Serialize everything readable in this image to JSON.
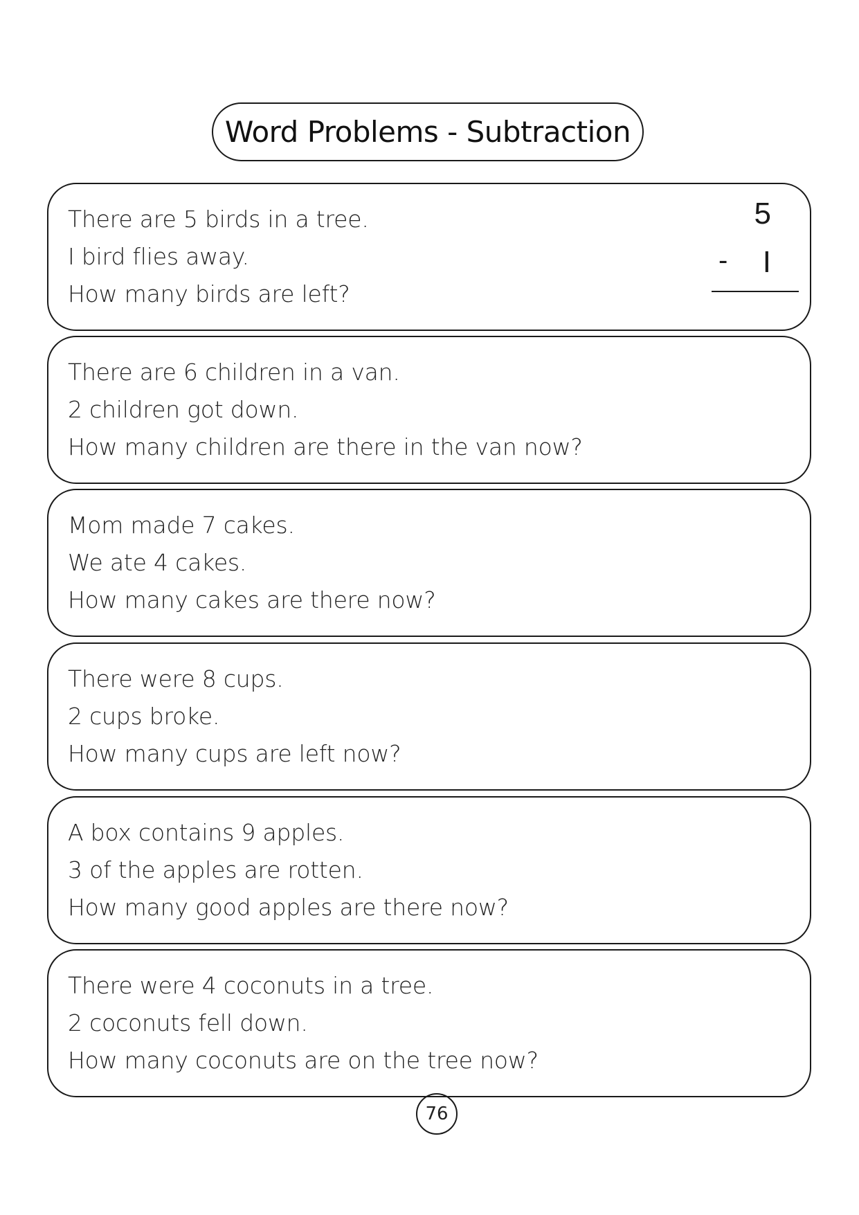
{
  "title": "Word Problems - Subtraction",
  "problems": [
    {
      "lines": [
        "There are 5 birds in a tree.",
        "I bird flies away.",
        "How many birds are left?"
      ],
      "example": {
        "top": "5",
        "operator": "-",
        "bottom": "I"
      }
    },
    {
      "lines": [
        "There are 6 children in a van.",
        "2 children got down.",
        "How many children are there in the van now?"
      ]
    },
    {
      "lines": [
        "Mom made 7 cakes.",
        "We ate 4 cakes.",
        "How many cakes are there now?"
      ]
    },
    {
      "lines": [
        "There were 8 cups.",
        "2 cups broke.",
        "How many cups are left now?"
      ]
    },
    {
      "lines": [
        "A box contains 9 apples.",
        "3 of the apples are rotten.",
        "How many good apples are there now?"
      ]
    },
    {
      "lines": [
        "There were 4 coconuts in a tree.",
        "2 coconuts fell down.",
        "How many coconuts are on the tree now?"
      ]
    }
  ],
  "page_number": "76"
}
